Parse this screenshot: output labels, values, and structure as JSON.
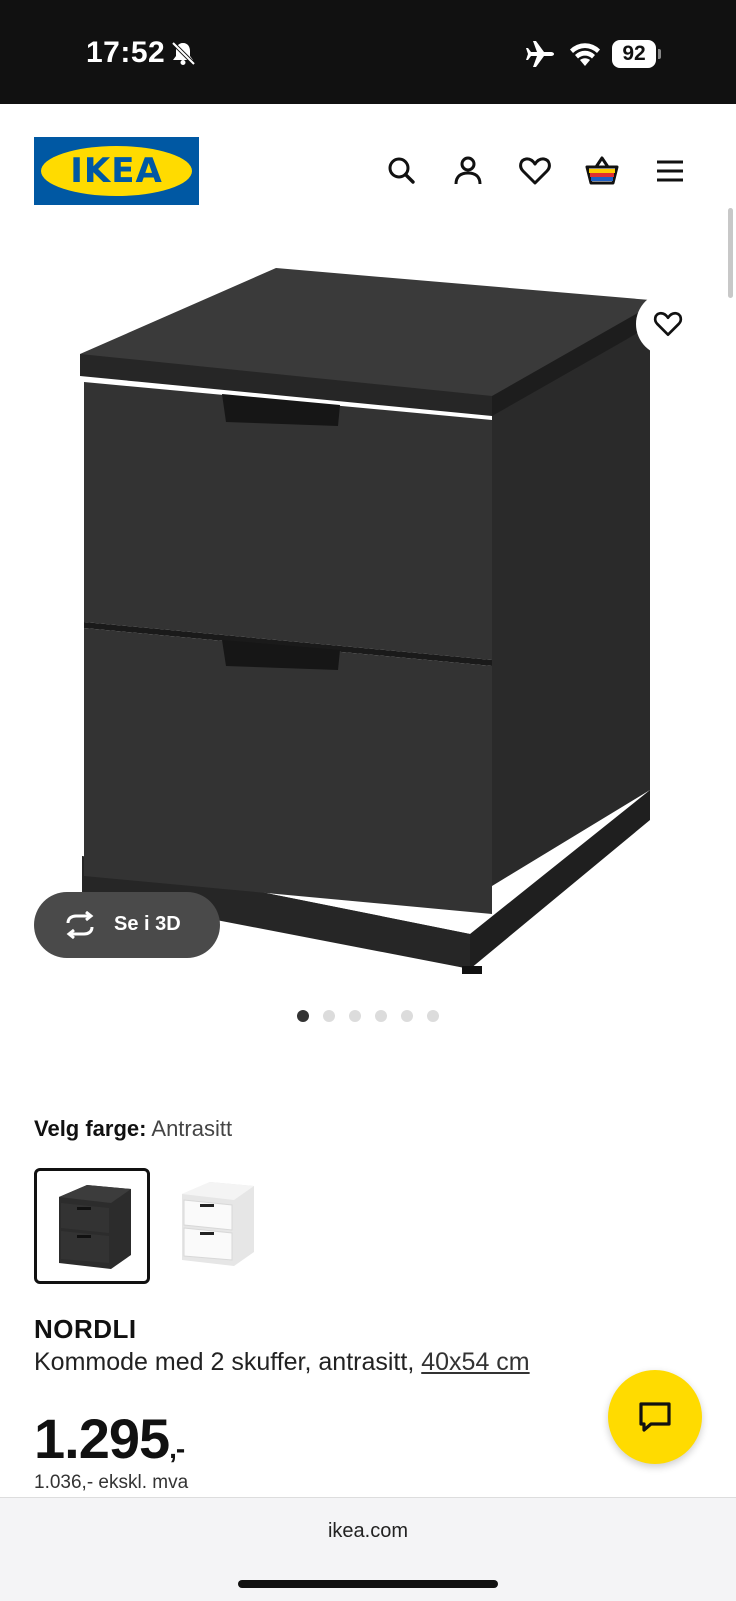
{
  "status_bar": {
    "time": "17:52",
    "battery": "92",
    "icons": [
      "bell-muted-icon",
      "airplane-icon",
      "wifi-icon",
      "battery-icon"
    ]
  },
  "header": {
    "logo_text": "IKEA",
    "icons": [
      "search-icon",
      "account-icon",
      "heart-icon",
      "basket-icon",
      "menu-icon"
    ]
  },
  "gallery": {
    "view_3d_label": "Se i 3D",
    "slide_count": 6,
    "active_slide": 1
  },
  "color_picker": {
    "label": "Velg farge:",
    "selected_value": "Antrasitt",
    "options": [
      "Antrasitt",
      "Hvit"
    ]
  },
  "product": {
    "name": "NORDLI",
    "description": "Kommode med 2 skuffer, antrasitt,",
    "dimensions": "40x54 cm",
    "price_main": "1.295",
    "price_suffix": ",-",
    "price_ex_vat": "1.036,- ekskl. mva"
  },
  "browser": {
    "url": "ikea.com"
  },
  "colors": {
    "ikea_blue": "#0058a3",
    "ikea_yellow": "#ffdb00",
    "status_bar_bg": "#111111",
    "badge_dark": "#4a4a4a"
  }
}
